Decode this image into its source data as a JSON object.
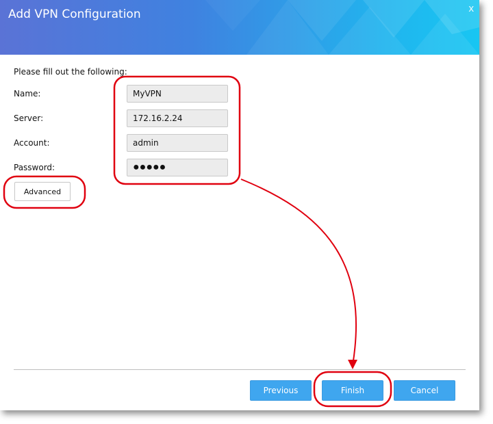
{
  "window": {
    "title": "Add VPN Configuration",
    "close_glyph": "x"
  },
  "form": {
    "intro": "Please fill out the following:",
    "name_label": "Name:",
    "name_value": "MyVPN",
    "server_label": "Server:",
    "server_value": "172.16.2.24",
    "account_label": "Account:",
    "account_value": "admin",
    "password_label": "Password:",
    "password_mask": "●●●●●",
    "advanced_label": "Advanced"
  },
  "footer": {
    "previous_label": "Previous",
    "finish_label": "Finish",
    "cancel_label": "Cancel"
  },
  "colors": {
    "title_gradient_start": "#5a73d6",
    "title_gradient_end": "#18c6f2",
    "button_blue": "#3fa6ef",
    "annotation_red": "#e0000f"
  },
  "icons": {
    "close": "close-icon"
  }
}
